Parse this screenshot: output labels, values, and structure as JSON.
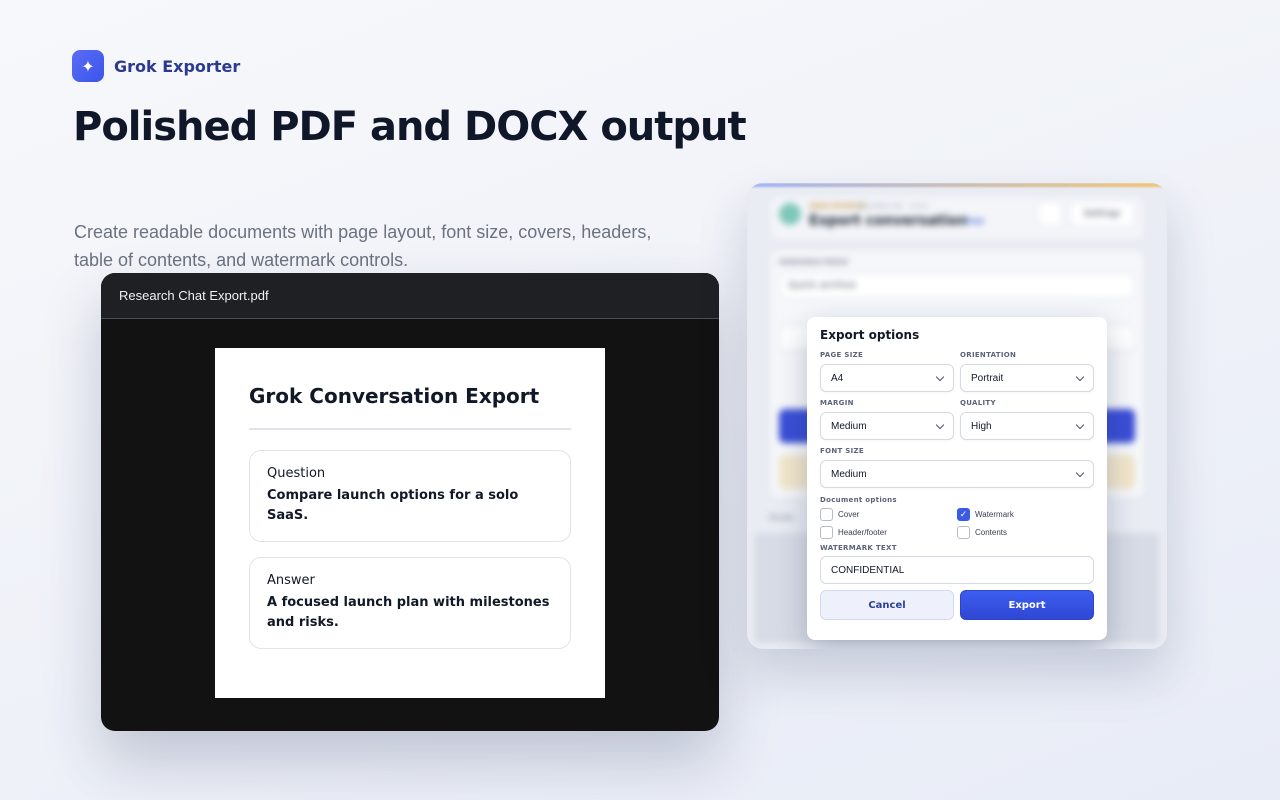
{
  "brand": {
    "name": "Grok Exporter",
    "icon": "sparkle-icon"
  },
  "hero": {
    "title": "Polished PDF and DOCX output",
    "subtitle": "Create readable documents with page layout, font size, covers, headers, table of contents, and watermark controls."
  },
  "viewer": {
    "filename": "Research Chat Export.pdf",
    "document": {
      "title": "Grok Conversation Export",
      "question_label": "Question",
      "question_text": "Compare launch options for a solo SaaS.",
      "answer_label": "Answer",
      "answer_text": "A focused launch plan with milestones and risks."
    }
  },
  "background_panel": {
    "tag": "GROK EXPORTER",
    "tag_by": "by Grokfan Dev · v0.6.0",
    "title": "Export conversation",
    "pill": "Page",
    "settings_label": "Settings",
    "preset_label": "WORKSPACE PRESET",
    "preset_value": "Quick archive",
    "ready": "Ready."
  },
  "modal": {
    "title": "Export options",
    "page_size_label": "PAGE SIZE",
    "page_size_value": "A4",
    "orientation_label": "ORIENTATION",
    "orientation_value": "Portrait",
    "margin_label": "MARGIN",
    "margin_value": "Medium",
    "quality_label": "QUALITY",
    "quality_value": "High",
    "font_size_label": "FONT SIZE",
    "font_size_value": "Medium",
    "doc_options_label": "Document options",
    "options": [
      {
        "label": "Cover",
        "checked": false
      },
      {
        "label": "Watermark",
        "checked": true
      },
      {
        "label": "Header/footer",
        "checked": false
      },
      {
        "label": "Contents",
        "checked": false
      }
    ],
    "watermark_label": "WATERMARK TEXT",
    "watermark_value": "CONFIDENTIAL",
    "cancel_label": "Cancel",
    "export_label": "Export"
  },
  "colors": {
    "accent": "#3b5be6",
    "brand_text": "#2a3a8f",
    "viewer_bg": "#121212"
  }
}
